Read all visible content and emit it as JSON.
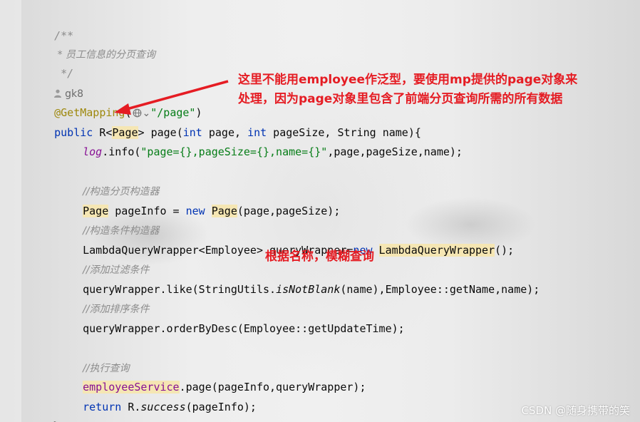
{
  "editor": {
    "javadoc": {
      "open": "/**",
      "text": " * 员工信息的分页查询",
      "close": " */"
    },
    "author_hint": "gk8",
    "mapping": {
      "annotation": "@GetMapping",
      "open_paren": "(",
      "path": "\"/page\"",
      "close_paren": ")"
    },
    "signature": {
      "kw_public": "public",
      "type_r": " R<",
      "type_page": "Page",
      "after_type": "> page(",
      "kw_int1": "int",
      "param1": " page, ",
      "kw_int2": "int",
      "param2": " pageSize, String name){"
    },
    "log_line": {
      "field": "log",
      "call": ".info(",
      "str": "\"page={},pageSize={},name={}\"",
      "rest": ",page,pageSize,name);"
    },
    "comment_page_ctor": "//构造分页构造器",
    "page_info_line": {
      "type": "Page",
      "mid": " pageInfo = ",
      "kw_new": "new",
      "space": " ",
      "ctor": "Page",
      "args": "(page,pageSize);"
    },
    "comment_cond_ctor": "//构造条件构造器",
    "wrapper_line": {
      "decl": "LambdaQueryWrapper<Employee> queryWrapper=",
      "kw_new": "new",
      "space": " ",
      "ctor": "LambdaQueryWrapper",
      "end": "();"
    },
    "comment_filter": "//添加过滤条件",
    "like_line": {
      "start": "queryWrapper.like(StringUtils.",
      "method": "isNotBlank",
      "end": "(name),Employee::getName,name);"
    },
    "comment_order": "//添加排序条件",
    "order_line": "queryWrapper.orderByDesc(Employee::getUpdateTime);",
    "comment_exec": "//执行查询",
    "exec_line": {
      "field": "employeeService",
      "end": ".page(pageInfo,queryWrapper);"
    },
    "return_line": {
      "kw_return": "return",
      "mid": " R.",
      "method": "success",
      "end": "(pageInfo);"
    },
    "closing_brace": "}"
  },
  "annotations": {
    "callout_line1": "这里不能用employee作泛型，要使用mp提供的page对象来",
    "callout_line2": "处理，因为page对象里包含了前端分页查询所需的所有数据",
    "filter_note": "根据名称，模糊查询",
    "color": "#e51c23"
  },
  "watermark": "CSDN @随身携带的笑",
  "icons": {
    "author": "user-icon",
    "mapping_link": "globe-icon"
  },
  "colors": {
    "keyword": "#0033b3",
    "string": "#067d17",
    "annotation": "#9e880d",
    "comment": "#8c8c8c",
    "highlight": "#f5e6b3"
  }
}
